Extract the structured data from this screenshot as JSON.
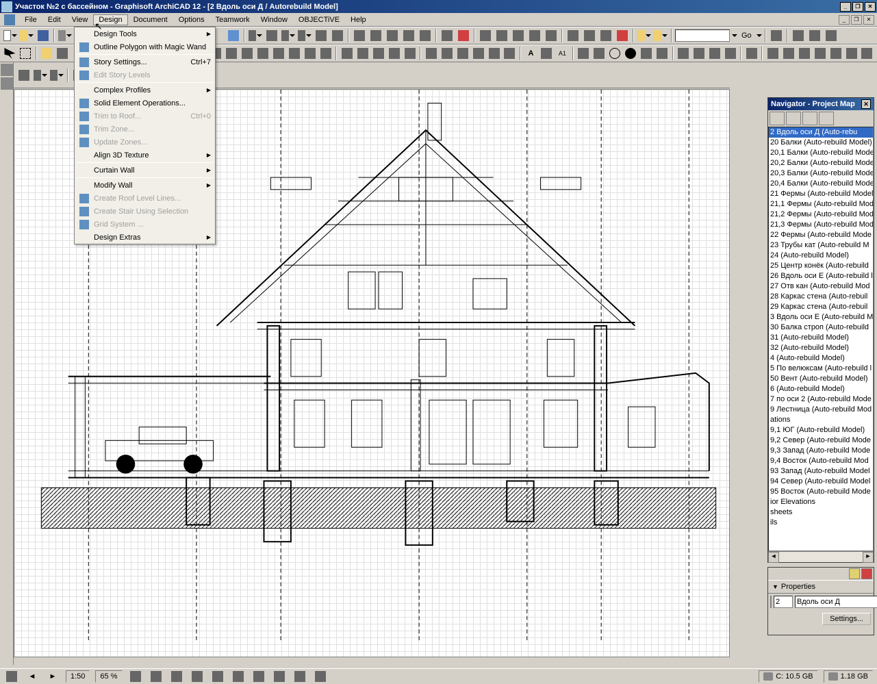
{
  "titlebar": {
    "title": "Участок №2 с бассейном   - Graphisoft ArchiCAD 12 - [2 Вдоль оси Д / Autorebuild Model]"
  },
  "menubar": {
    "items": [
      "File",
      "Edit",
      "View",
      "Design",
      "Document",
      "Options",
      "Teamwork",
      "Window",
      "OBJECTiVE",
      "Help"
    ],
    "active": "Design"
  },
  "design_menu": {
    "items": [
      {
        "label": "Design Tools",
        "submenu": true
      },
      {
        "label": "Outline Polygon with Magic Wand",
        "icon": "wand"
      },
      {
        "sep": true
      },
      {
        "label": "Story Settings...",
        "shortcut": "Ctrl+7",
        "icon": "story"
      },
      {
        "label": "Edit Story Levels",
        "disabled": true,
        "icon": "levels"
      },
      {
        "sep": true
      },
      {
        "label": "Complex Profiles",
        "submenu": true
      },
      {
        "label": "Solid Element Operations...",
        "icon": "solid"
      },
      {
        "label": "Trim to Roof...",
        "shortcut": "Ctrl+0",
        "disabled": true,
        "icon": "trim"
      },
      {
        "label": "Trim Zone...",
        "disabled": true,
        "icon": "trimz"
      },
      {
        "label": "Update Zones...",
        "disabled": true,
        "icon": "update"
      },
      {
        "label": "Align 3D Texture",
        "submenu": true
      },
      {
        "sep": true
      },
      {
        "label": "Curtain Wall",
        "submenu": true
      },
      {
        "sep": true
      },
      {
        "label": "Modify Wall",
        "submenu": true
      },
      {
        "label": "Create Roof Level Lines...",
        "disabled": true,
        "icon": "roofl"
      },
      {
        "label": "Create Stair Using Selection",
        "disabled": true,
        "icon": "stair"
      },
      {
        "label": "Grid System ...",
        "disabled": true,
        "icon": "grid"
      },
      {
        "label": "Design Extras",
        "submenu": true
      }
    ]
  },
  "toolbar_input": {
    "go_label": "Go"
  },
  "navigator": {
    "title": "Navigator - Project Map",
    "selected": "2 Вдоль оси Д (Auto-rebu",
    "items": [
      "2 Вдоль оси Д (Auto-rebu",
      "20 Балки (Auto-rebuild Model)",
      "20,1 Балки (Auto-rebuild Mode",
      "20,2 Балки (Auto-rebuild Mode",
      "20,3 Балки (Auto-rebuild Mode",
      "20,4 Балки (Auto-rebuild Mode",
      "21 Фермы (Auto-rebuild Model)",
      "21,1 Фермы (Auto-rebuild Mod",
      "21,2 Фермы (Auto-rebuild Mod",
      "21,3 Фермы (Auto-rebuild Mod",
      "22 Фермы (Auto-rebuild Mode",
      "23 Трубы кат (Auto-rebuild M",
      "24 (Auto-rebuild Model)",
      "25 Центр конёк (Auto-rebuild",
      "26 Вдоль оси Е (Auto-rebuild l",
      "27 Отв кан (Auto-rebuild Mod",
      "28 Каркас стена (Auto-rebuil",
      "29 Каркас стена (Auto-rebuil",
      "3 Вдоль оси Е (Auto-rebuild M",
      "30 Балка строп (Auto-rebuild",
      "31 (Auto-rebuild Model)",
      "32 (Auto-rebuild Model)",
      "4 (Auto-rebuild Model)",
      "5 По велюксам (Auto-rebuild l",
      "50 Вент (Auto-rebuild Model)",
      "6 (Auto-rebuild Model)",
      "7 по оси 2 (Auto-rebuild Mode",
      "9 Лестница (Auto-rebuild Mod",
      "ations",
      "9,1 ЮГ (Auto-rebuild Model)",
      "9,2 Север (Auto-rebuild Mode",
      "9,3 Запад (Auto-rebuild Mode",
      "9,4 Восток (Auto-rebuild Mod",
      "93 Запад (Auto-rebuild Model",
      "94 Север (Auto-rebuild Model",
      "95 Восток (Auto-rebuild Mode",
      "ior Elevations",
      "sheets",
      "ils"
    ]
  },
  "properties": {
    "header": "Properties",
    "id_value": "2",
    "name_value": "Вдоль оси Д",
    "settings_label": "Settings..."
  },
  "statusbar": {
    "scale": "1:50",
    "zoom": "65 %",
    "disk_c": "C: 10.5 GB",
    "disk_d": "1.18 GB"
  }
}
